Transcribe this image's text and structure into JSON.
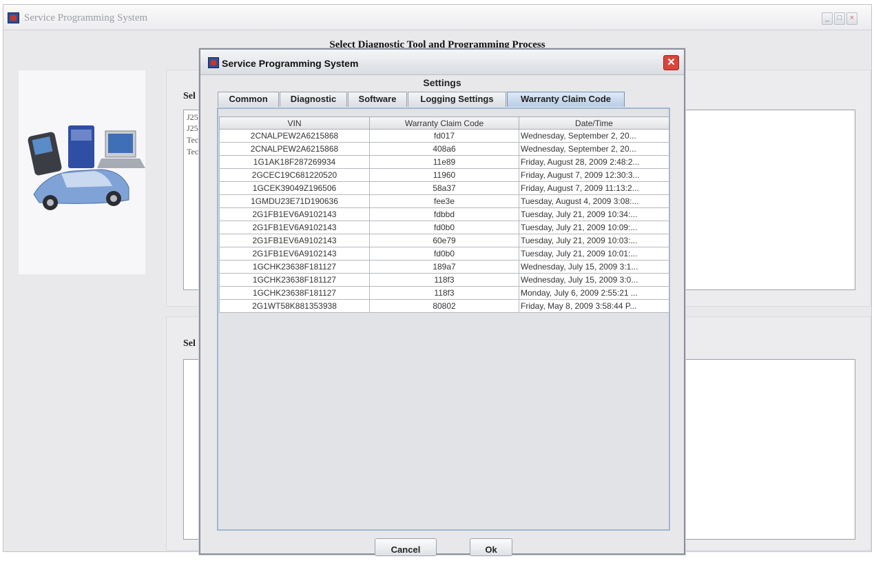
{
  "main_window": {
    "title": "Service Programming System",
    "heading": "Select Diagnostic Tool and Programming Process",
    "tool_group_label": "Sel",
    "process_group_label": "Sel",
    "tool_list_items": [
      "J25",
      "J25",
      "Tec",
      "Tec"
    ]
  },
  "dialog": {
    "title": "Service Programming System",
    "settings_title": "Settings",
    "tabs": [
      {
        "label": "Common",
        "active": false
      },
      {
        "label": "Diagnostic",
        "active": false
      },
      {
        "label": "Software",
        "active": false
      },
      {
        "label": "Logging Settings",
        "active": false
      },
      {
        "label": "Warranty Claim Code",
        "active": true
      }
    ],
    "table": {
      "columns": [
        "VIN",
        "Warranty Claim Code",
        "Date/Time"
      ],
      "rows": [
        [
          "2CNALPEW2A6215868",
          "fd017",
          "Wednesday, September 2, 20..."
        ],
        [
          "2CNALPEW2A6215868",
          "408a6",
          "Wednesday, September 2, 20..."
        ],
        [
          "1G1AK18F287269934",
          "11e89",
          "Friday, August 28, 2009 2:48:2..."
        ],
        [
          "2GCEC19C681220520",
          "11960",
          "Friday, August 7, 2009 12:30:3..."
        ],
        [
          "1GCEK39049Z196506",
          "58a37",
          "Friday, August 7, 2009 11:13:2..."
        ],
        [
          "1GMDU23E71D190636",
          "fee3e",
          "Tuesday, August 4, 2009 3:08:..."
        ],
        [
          "2G1FB1EV6A9102143",
          "fdbbd",
          "Tuesday, July 21, 2009 10:34:..."
        ],
        [
          "2G1FB1EV6A9102143",
          "fd0b0",
          "Tuesday, July 21, 2009 10:09:..."
        ],
        [
          "2G1FB1EV6A9102143",
          "60e79",
          "Tuesday, July 21, 2009 10:03:..."
        ],
        [
          "2G1FB1EV6A9102143",
          "fd0b0",
          "Tuesday, July 21, 2009 10:01:..."
        ],
        [
          "1GCHK23638F181127",
          "189a7",
          "Wednesday, July 15, 2009 3:1..."
        ],
        [
          "1GCHK23638F181127",
          "118f3",
          "Wednesday, July 15, 2009 3:0..."
        ],
        [
          "1GCHK23638F181127",
          "118f3",
          "Monday, July 6, 2009 2:55:21 ..."
        ],
        [
          "2G1WT58K881353938",
          "80802",
          "Friday, May 8, 2009 3:58:44 P..."
        ]
      ]
    },
    "cancel_label": "Cancel",
    "ok_label": "Ok"
  }
}
